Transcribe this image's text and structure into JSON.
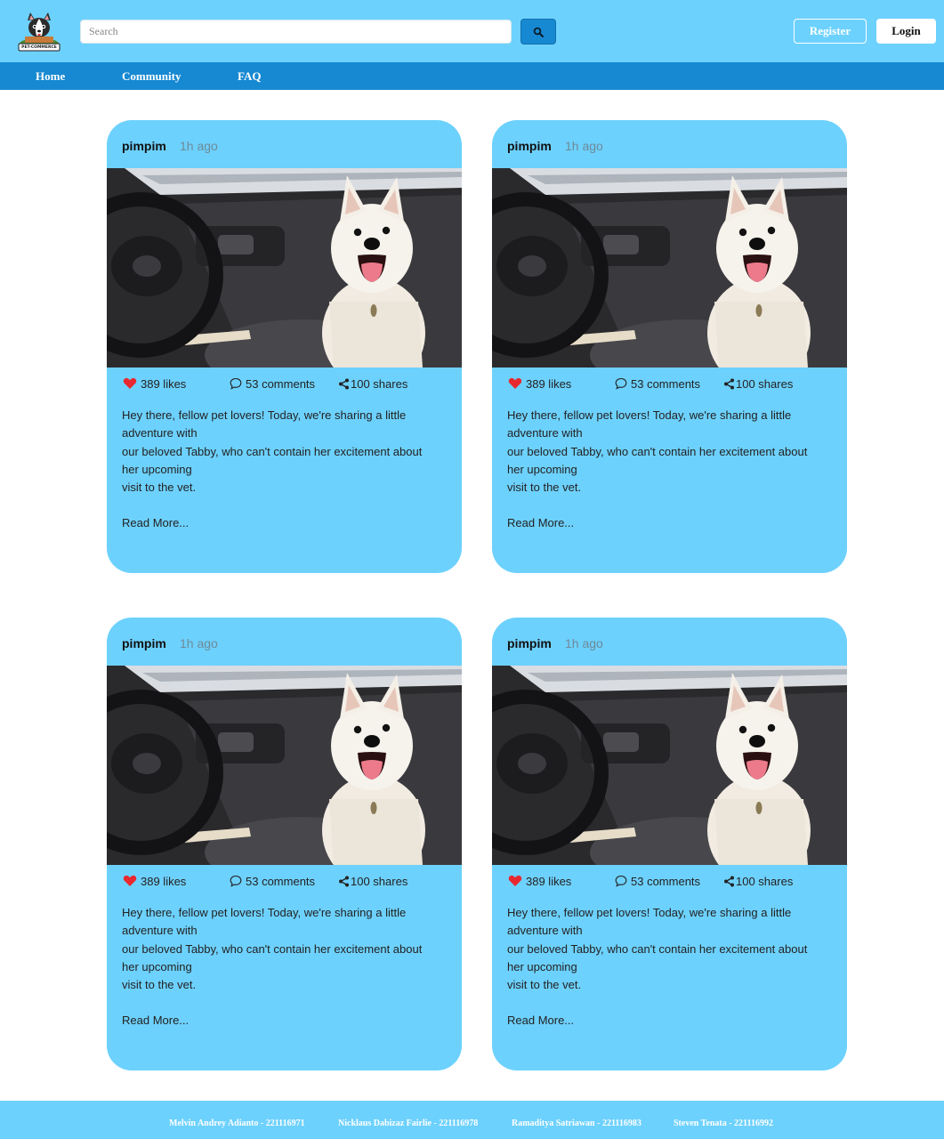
{
  "header": {
    "search_placeholder": "Search",
    "register_label": "Register",
    "login_label": "Login"
  },
  "nav": {
    "items": [
      "Home",
      "Community",
      "FAQ"
    ]
  },
  "posts": [
    {
      "user": "pimpim",
      "time": "1h ago",
      "likes": "389 likes",
      "comments": "53 comments",
      "shares": "100 shares",
      "body_lines": [
        "Hey there, fellow pet lovers! Today, we're sharing a little",
        "adventure with",
        "our beloved Tabby, who can't contain her excitement about",
        "her upcoming",
        "visit to the vet."
      ],
      "read_more": "Read More..."
    },
    {
      "user": "pimpim",
      "time": "1h ago",
      "likes": "389 likes",
      "comments": "53 comments",
      "shares": "100 shares",
      "body_lines": [
        "Hey there, fellow pet lovers! Today, we're sharing a little",
        "adventure with",
        "our beloved Tabby, who can't contain her excitement about",
        "her upcoming",
        "visit to the vet."
      ],
      "read_more": "Read More..."
    },
    {
      "user": "pimpim",
      "time": "1h ago",
      "likes": "389 likes",
      "comments": "53 comments",
      "shares": "100 shares",
      "body_lines": [
        "Hey there, fellow pet lovers! Today, we're sharing a little",
        "adventure with",
        "our beloved Tabby, who can't contain her excitement about",
        "her upcoming",
        "visit to the vet."
      ],
      "read_more": "Read More..."
    },
    {
      "user": "pimpim",
      "time": "1h ago",
      "likes": "389 likes",
      "comments": "53 comments",
      "shares": "100 shares",
      "body_lines": [
        "Hey there, fellow pet lovers! Today, we're sharing a little",
        "adventure with",
        "our beloved Tabby, who can't contain her excitement about",
        "her upcoming",
        "visit to the vet."
      ],
      "read_more": "Read More..."
    }
  ],
  "footer": {
    "credits": [
      "Melvin Andrey Adianto - 221116971",
      "Nicklaus Dabizaz Fairlie - 221116978",
      "Ramaditya Satriawan - 221116983",
      "Steven Tenata - 221116992"
    ]
  },
  "logo_text": "PET-COMMERCE",
  "icons": {
    "search": "search-icon",
    "like": "heart-icon",
    "comment": "comment-bubble-icon",
    "share": "share-icon"
  },
  "colors": {
    "header_bg": "#6dd1fd",
    "nav_bg": "#1789d2",
    "card_bg": "#6dd1fd",
    "heart": "#e8282e"
  }
}
